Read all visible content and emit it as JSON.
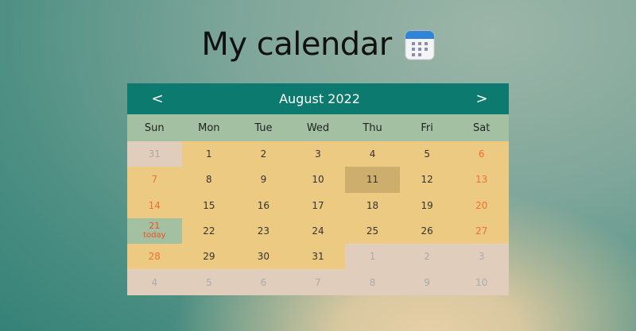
{
  "title": "My calendar",
  "icon": "calendar-icon",
  "colors": {
    "header_bg": "#0d7a6f",
    "weekday_bg": "#a3c0a2",
    "day_bg": "#ecca82",
    "other_month_bg": "#e1cdbc",
    "selected_bg": "#cdae6c",
    "weekend_text": "#f07032"
  },
  "calendar": {
    "prev": "<",
    "next": ">",
    "month": "August 2022",
    "weekdays": [
      "Sun",
      "Mon",
      "Tue",
      "Wed",
      "Thu",
      "Fri",
      "Sat"
    ],
    "today_label": "today",
    "selected_day": "11",
    "today_day": "21",
    "weeks": [
      [
        {
          "d": "31",
          "o": true
        },
        {
          "d": "1"
        },
        {
          "d": "2"
        },
        {
          "d": "3"
        },
        {
          "d": "4"
        },
        {
          "d": "5"
        },
        {
          "d": "6"
        }
      ],
      [
        {
          "d": "7"
        },
        {
          "d": "8"
        },
        {
          "d": "9"
        },
        {
          "d": "10"
        },
        {
          "d": "11"
        },
        {
          "d": "12"
        },
        {
          "d": "13"
        }
      ],
      [
        {
          "d": "14"
        },
        {
          "d": "15"
        },
        {
          "d": "16"
        },
        {
          "d": "17"
        },
        {
          "d": "18"
        },
        {
          "d": "19"
        },
        {
          "d": "20"
        }
      ],
      [
        {
          "d": "21"
        },
        {
          "d": "22"
        },
        {
          "d": "23"
        },
        {
          "d": "24"
        },
        {
          "d": "25"
        },
        {
          "d": "26"
        },
        {
          "d": "27"
        }
      ],
      [
        {
          "d": "28"
        },
        {
          "d": "29"
        },
        {
          "d": "30"
        },
        {
          "d": "31"
        },
        {
          "d": "1",
          "o": true
        },
        {
          "d": "2",
          "o": true
        },
        {
          "d": "3",
          "o": true
        }
      ],
      [
        {
          "d": "4",
          "o": true
        },
        {
          "d": "5",
          "o": true
        },
        {
          "d": "6",
          "o": true
        },
        {
          "d": "7",
          "o": true
        },
        {
          "d": "8",
          "o": true
        },
        {
          "d": "9",
          "o": true
        },
        {
          "d": "10",
          "o": true
        }
      ]
    ]
  }
}
